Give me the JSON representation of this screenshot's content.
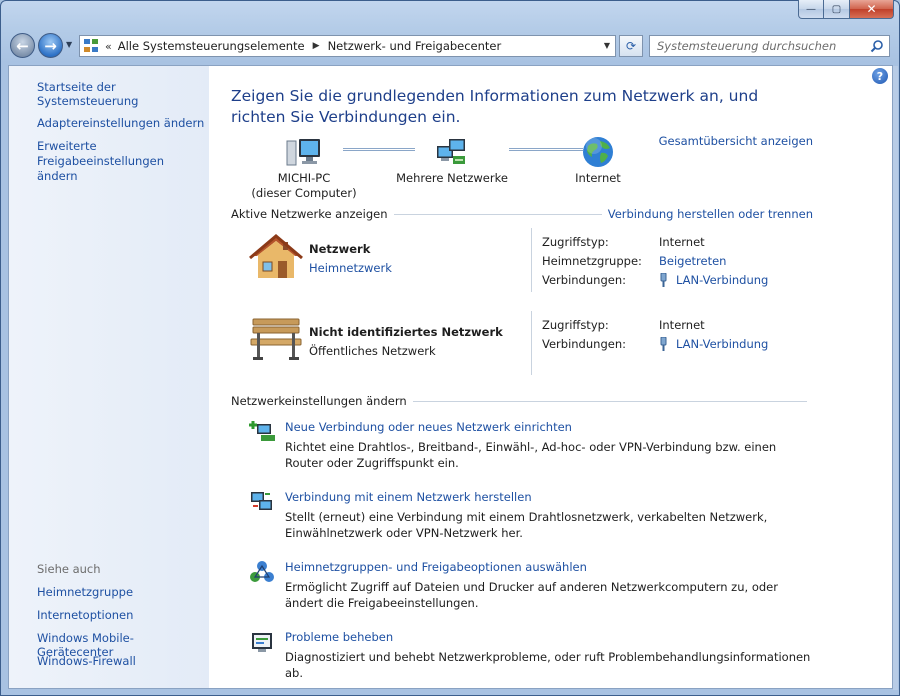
{
  "window": {
    "minimize_glyph": "—",
    "maximize_glyph": "▢",
    "close_glyph": "✕"
  },
  "address_bar": {
    "prefix": "«",
    "crumbs": [
      "Alle Systemsteuerungselemente",
      "Netzwerk- und Freigabecenter"
    ],
    "separator": "▶"
  },
  "search": {
    "placeholder": "Systemsteuerung durchsuchen"
  },
  "sidebar": {
    "home": "Startseite der Systemsteuerung",
    "adapter": "Adaptereinstellungen ändern",
    "sharing": "Erweiterte Freigabeeinstellungen ändern",
    "see_also": "Siehe auch",
    "links": [
      "Heimnetzgruppe",
      "Internetoptionen",
      "Windows Mobile-Gerätecenter",
      "Windows-Firewall"
    ]
  },
  "main": {
    "title": "Zeigen Sie die grundlegenden Informationen zum Netzwerk an, und richten Sie Verbindungen ein.",
    "overview_link": "Gesamtübersicht anzeigen",
    "map": {
      "pc_name": "MICHI-PC",
      "pc_sub": "(dieser Computer)",
      "multi": "Mehrere Netzwerke",
      "internet": "Internet"
    },
    "active_heading": "Aktive Netzwerke anzeigen",
    "connect_link": "Verbindung herstellen oder trennen",
    "networks": [
      {
        "name": "Netzwerk",
        "type": "Heimnetzwerk",
        "props": [
          {
            "k": "Zugriffstyp:",
            "v": "Internet"
          },
          {
            "k": "Heimnetzgruppe:",
            "v": "Beigetreten"
          },
          {
            "k": "Verbindungen:",
            "v": "LAN-Verbindung"
          }
        ]
      },
      {
        "name": "Nicht identifiziertes Netzwerk",
        "type": "Öffentliches Netzwerk",
        "props": [
          {
            "k": "Zugriffstyp:",
            "v": "Internet"
          },
          {
            "k": "Verbindungen:",
            "v": "LAN-Verbindung"
          }
        ]
      }
    ],
    "change_heading": "Netzwerkeinstellungen ändern",
    "tasks": [
      {
        "title": "Neue Verbindung oder neues Netzwerk einrichten",
        "desc": "Richtet eine Drahtlos-, Breitband-, Einwähl-, Ad-hoc- oder VPN-Verbindung bzw. einen Router oder Zugriffspunkt ein."
      },
      {
        "title": "Verbindung mit einem Netzwerk herstellen",
        "desc": "Stellt (erneut) eine Verbindung mit einem Drahtlosnetzwerk, verkabelten Netzwerk, Einwählnetzwerk oder VPN-Netzwerk her."
      },
      {
        "title": "Heimnetzgruppen- und Freigabeoptionen auswählen",
        "desc": "Ermöglicht Zugriff auf Dateien und Drucker auf anderen Netzwerkcomputern zu, oder ändert die Freigabeeinstellungen."
      },
      {
        "title": "Probleme beheben",
        "desc": "Diagnostiziert und behebt Netzwerkprobleme, oder ruft Problembehandlungsinformationen ab."
      }
    ]
  },
  "icons": {
    "help": "?",
    "back": "←",
    "forward": "→",
    "refresh": "⟳"
  }
}
